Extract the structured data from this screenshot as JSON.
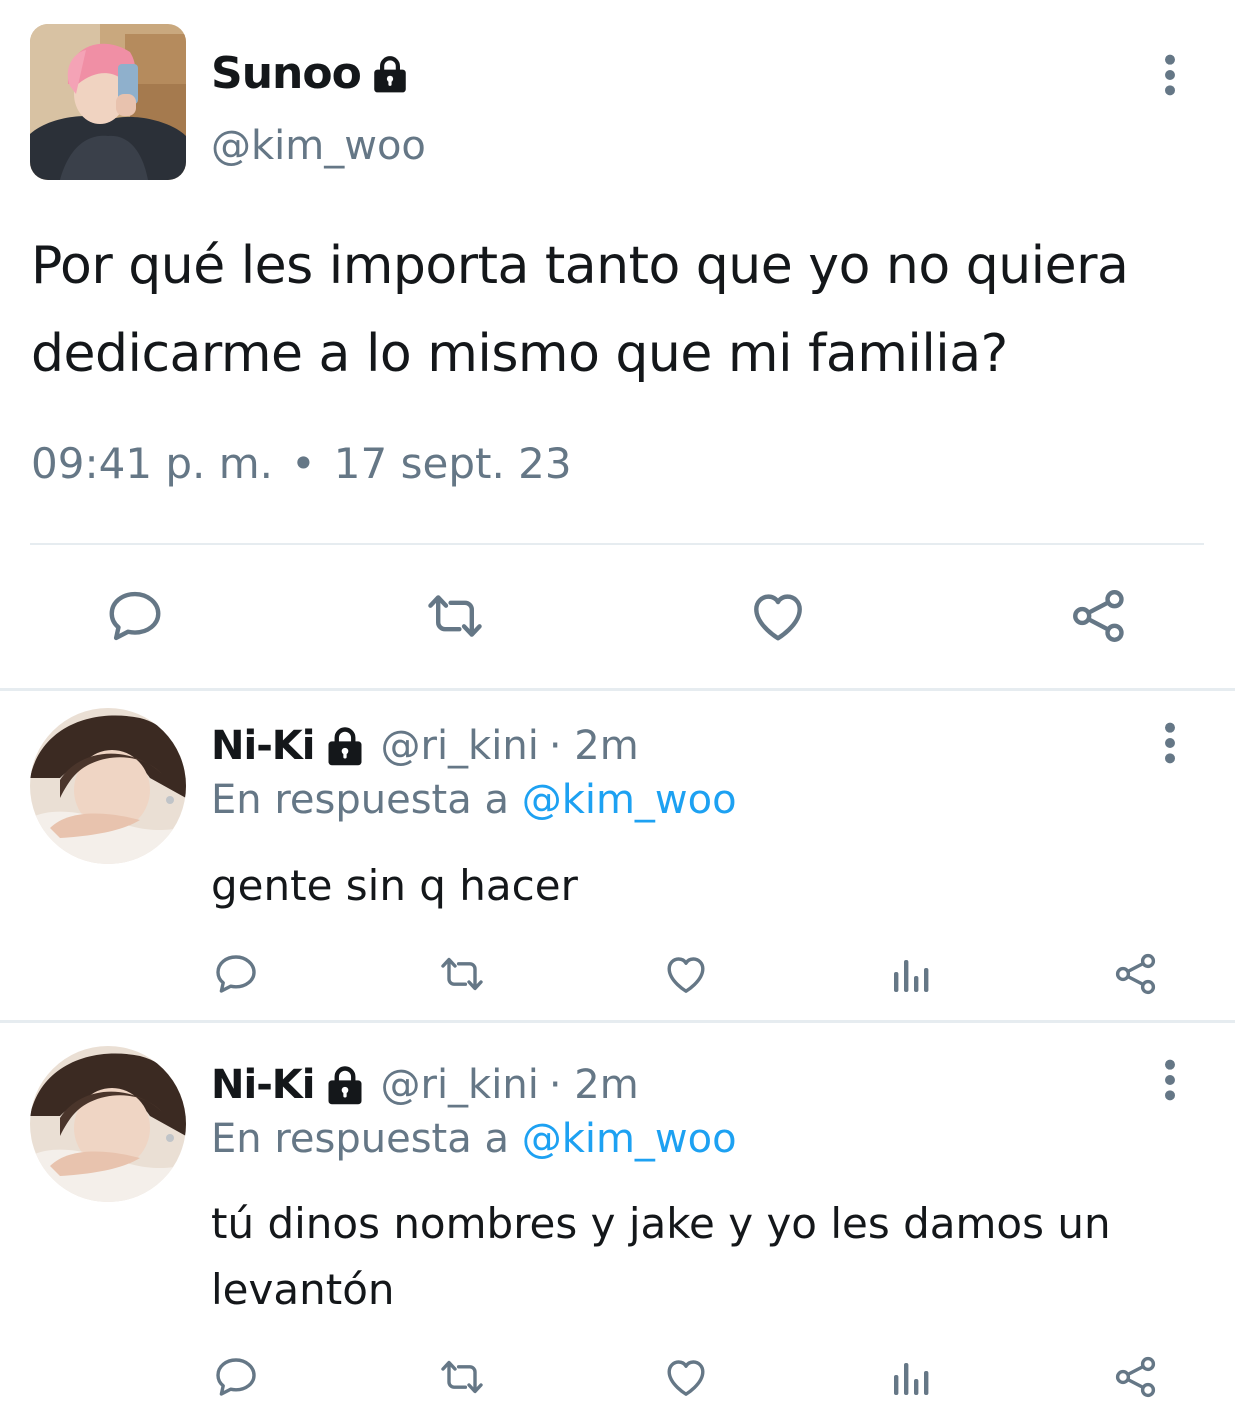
{
  "main_tweet": {
    "display_name": "Sunoo",
    "handle": "@kim_woo",
    "text": "Por qué les importa tanto que yo no quiera dedicarme a lo mismo que mi familia?",
    "time": "09:41 p. m.",
    "separator": "•",
    "date": "17 sept. 23",
    "actions": [
      "reply-icon",
      "retweet-icon",
      "like-icon",
      "share-icon"
    ]
  },
  "replies": [
    {
      "display_name": "Ni-Ki",
      "handle": "@ri_kini",
      "time": "· 2m",
      "reply_prefix": "En respuesta a ",
      "reply_mention": "@kim_woo",
      "text": "gente sin q hacer",
      "actions": [
        "reply-icon",
        "retweet-icon",
        "like-icon",
        "analytics-icon",
        "share-icon"
      ]
    },
    {
      "display_name": "Ni-Ki",
      "handle": "@ri_kini",
      "time": "· 2m",
      "reply_prefix": "En respuesta a ",
      "reply_mention": "@kim_woo",
      "text": "tú dinos nombres y jake y yo les damos un levantón",
      "actions": [
        "reply-icon",
        "retweet-icon",
        "like-icon",
        "analytics-icon",
        "share-icon"
      ]
    }
  ],
  "colors": {
    "text": "#14171a",
    "secondary": "#657786",
    "link": "#1da1f2",
    "divider": "#e6ecf0"
  }
}
